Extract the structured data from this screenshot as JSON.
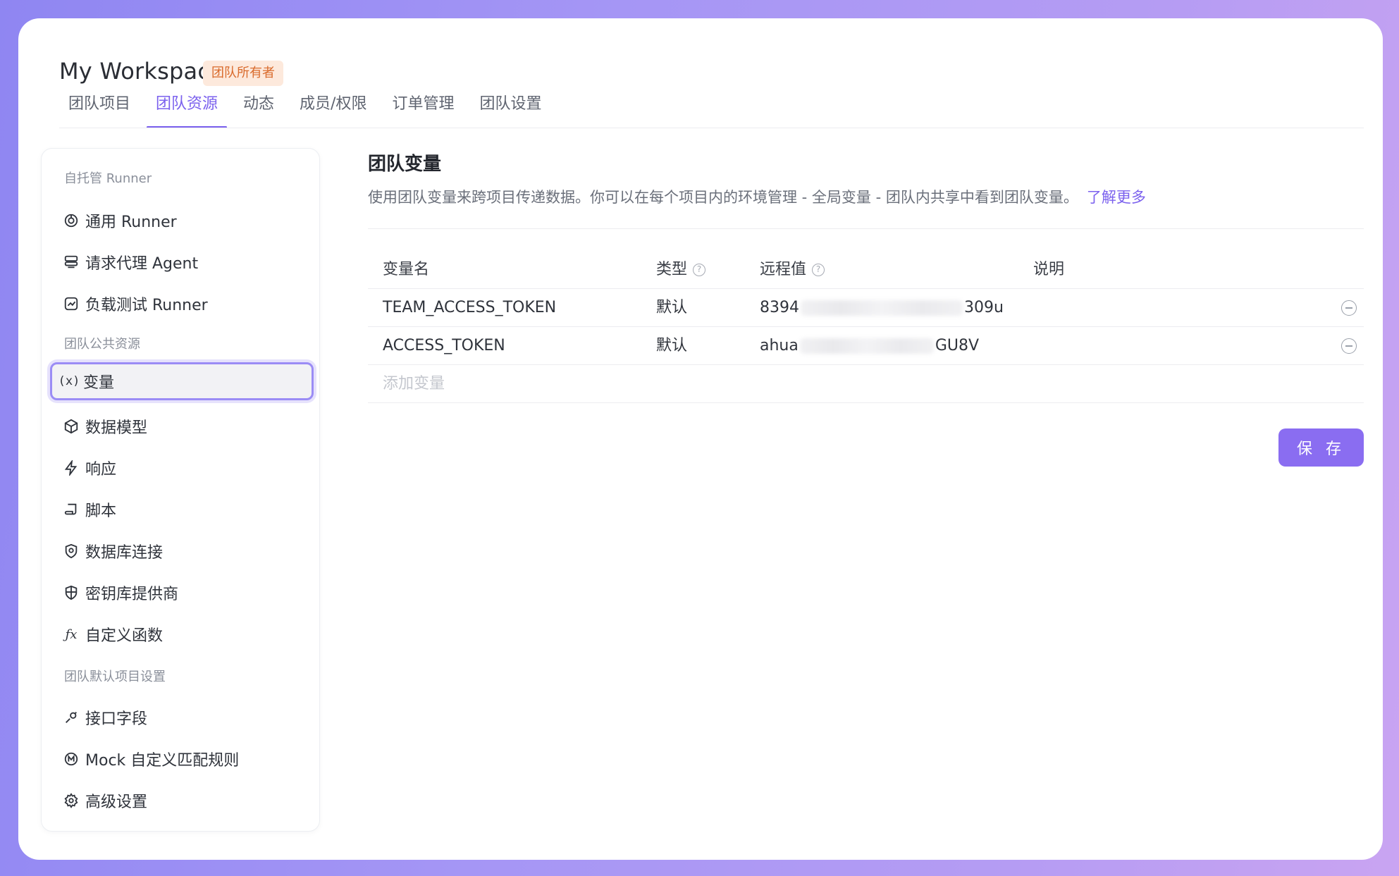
{
  "header": {
    "title": "My Workspace",
    "badge": "团队所有者"
  },
  "tabs": [
    {
      "label": "团队项目",
      "active": false
    },
    {
      "label": "团队资源",
      "active": true
    },
    {
      "label": "动态",
      "active": false
    },
    {
      "label": "成员/权限",
      "active": false
    },
    {
      "label": "订单管理",
      "active": false
    },
    {
      "label": "团队设置",
      "active": false
    }
  ],
  "sidebar": {
    "groups": [
      {
        "title": "自托管 Runner"
      },
      {
        "title": "团队公共资源"
      },
      {
        "title": "团队默认项目设置"
      }
    ],
    "items": [
      {
        "label": "通用 Runner",
        "icon": "runner-icon"
      },
      {
        "label": "请求代理 Agent",
        "icon": "agent-icon"
      },
      {
        "label": "负载测试 Runner",
        "icon": "chart-icon"
      },
      {
        "label": "变量",
        "icon": "variable-icon",
        "active": true
      },
      {
        "label": "数据模型",
        "icon": "cube-icon"
      },
      {
        "label": "响应",
        "icon": "lightning-icon"
      },
      {
        "label": "脚本",
        "icon": "script-icon"
      },
      {
        "label": "数据库连接",
        "icon": "database-icon"
      },
      {
        "label": "密钥库提供商",
        "icon": "shield-icon"
      },
      {
        "label": "自定义函数",
        "icon": "function-icon"
      },
      {
        "label": "接口字段",
        "icon": "link-icon"
      },
      {
        "label": "Mock 自定义匹配规则",
        "icon": "mock-icon"
      },
      {
        "label": "高级设置",
        "icon": "gear-icon"
      }
    ]
  },
  "main": {
    "title": "团队变量",
    "description": "使用团队变量来跨项目传递数据。你可以在每个项目内的环境管理 - 全局变量 - 团队内共享中看到团队变量。",
    "learn_more": "了解更多",
    "table": {
      "headers": [
        "变量名",
        "类型",
        "远程值",
        "说明"
      ],
      "rows": [
        {
          "name": "TEAM_ACCESS_TOKEN",
          "type": "默认",
          "value_prefix": "8394",
          "value_suffix": "309u",
          "note": ""
        },
        {
          "name": "ACCESS_TOKEN",
          "type": "默认",
          "value_prefix": "ahua",
          "value_suffix": "GU8V",
          "note": ""
        }
      ],
      "add_placeholder": "添加变量"
    },
    "save_label": "保 存"
  },
  "colors": {
    "accent": "#7b61ee",
    "button": "#8a6df1",
    "badge_bg": "#fde9dc",
    "badge_text": "#d96a2b"
  }
}
